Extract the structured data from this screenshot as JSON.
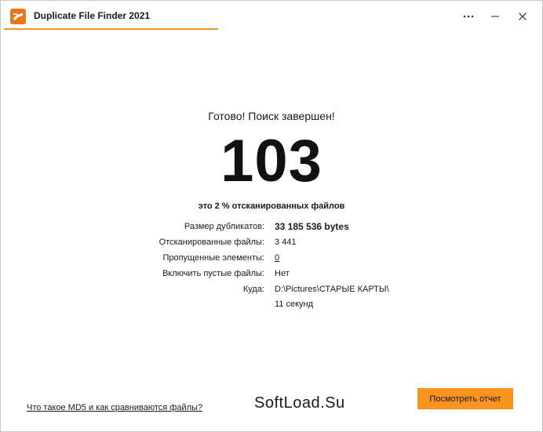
{
  "window": {
    "title": "Duplicate File Finder 2021",
    "accent_color": "#f39a1c",
    "controls": {
      "more_icon": "more-horizontal-icon",
      "minimize_icon": "minimize-icon",
      "close_icon": "close-icon"
    }
  },
  "result": {
    "status_title": "Готово! Поиск завершен!",
    "duplicate_count": "103",
    "percent_line": "это 2 % отсканированных файлов"
  },
  "stats": [
    {
      "label": "Размер дубликатов:",
      "value": "33 185 536 bytes"
    },
    {
      "label": "Отсканированные файлы:",
      "value": "3 441"
    },
    {
      "label": "Пропущенные элементы:",
      "value": "0"
    },
    {
      "label": "Включить пустые файлы:",
      "value": "Нет"
    },
    {
      "label": "Куда:",
      "value": "D:\\Pictures\\СТАРЫЕ КАРТЫ\\"
    },
    {
      "label": "",
      "value": "11 секунд"
    }
  ],
  "footer": {
    "help_link": "Что такое MD5 и как сравниваются файлы?",
    "watermark": "SoftLoad.Su",
    "report_button": "Посмотреть отчет",
    "report_button_color": "#f7931e"
  }
}
